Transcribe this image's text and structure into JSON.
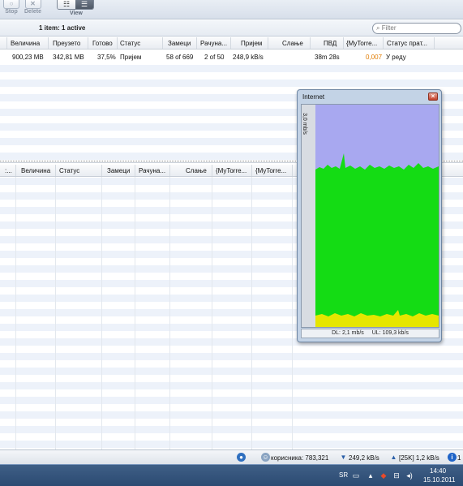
{
  "toolbar": {
    "stop_label": "Stop",
    "delete_label": "Delete",
    "view_label": "View"
  },
  "filterbar": {
    "active_count": "1 item: 1 active",
    "filter_placeholder": "Filter"
  },
  "top_table": {
    "headers": [
      "Величина",
      "Преузето",
      "Готово",
      "Статус",
      "Замеци",
      "Рачуна...",
      "Пријем",
      "Слање",
      "ПВД",
      "{MyTorre...",
      "Статус прат..."
    ],
    "row": {
      "size": "900,23 MB",
      "downloaded": "342,81 MB",
      "done": "37,5%",
      "status": "Пријем",
      "pieces": "58 of 669",
      "peers": "2 of 50",
      "download": "248,9 kB/s",
      "upload": "",
      "eta": "38m 28s",
      "mytorrent": "0,007",
      "tracker_status": "У реду"
    }
  },
  "bottom_table": {
    "headers": [
      ":...",
      "Величина",
      "Статус",
      "Замеци",
      "Рачуна...",
      "Слање",
      "{MyTorre...",
      "{MyTorre..."
    ]
  },
  "netwin": {
    "title": "Internet",
    "axis_label": "3,0 mb/s",
    "dl": "DL: 2,1 mb/s",
    "ul": "UL: 109,3 kb/s"
  },
  "statusbar": {
    "users": "корисника: 783,321",
    "down_speed": "249,2 kB/s",
    "up_speed": "[25K] 1,2 kB/s",
    "info_count": "1"
  },
  "taskbar": {
    "lang": "SR",
    "time": "14:40",
    "date": "15.10.2011"
  },
  "colors": {
    "graph_bg": "#a8a8f0",
    "graph_dl": "#14dc14",
    "graph_ul": "#e6e600",
    "orange_text": "#e07b00"
  }
}
